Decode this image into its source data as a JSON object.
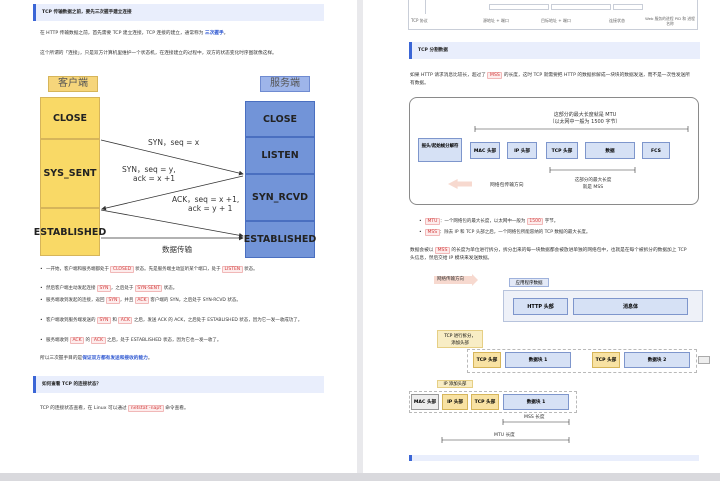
{
  "left": {
    "section_title": "TCP 传输数据之前，要先三次握手建立连接",
    "intro": [
      "在 HTTP 传输数据之前，首先需要 TCP 建立连接，TCP 连接的建立，通常称为 ",
      "三次握手",
      "。"
    ],
    "para2": "这个所谓的「连接」，只是双方计算机里维护一个状态机，在连接建立的过程中，双方的状态变化时序图就像这样。",
    "diagram": {
      "client_label": "客户端",
      "server_label": "服务端",
      "client_states": [
        "CLOSE",
        "SYS_SENT",
        "ESTABLISHED"
      ],
      "server_states": [
        "CLOSE",
        "LISTEN",
        "SYN_RCVD",
        "ESTABLISHED"
      ],
      "msg1": "SYN，seq = x",
      "msg2a": "SYN，seq = y,",
      "msg2b": "ack = x +1",
      "msg3a": "ACK，seq = x +1,",
      "msg3b": "ack = y + 1",
      "msg4": "数据传输"
    },
    "bullets": [
      {
        "pre": "一开始，客户端和服务端都处于 ",
        "t1": "CLOSED",
        "mid": " 状态。先是服务端主动监听某个端口，处于 ",
        "t2": "LISTEN",
        "post": " 状态。"
      },
      {
        "pre": "然后客户端主动发起连接 ",
        "t1": "SYN",
        "mid": "，之后处于 ",
        "t2": "SYN-SENT",
        "post": " 状态。"
      },
      {
        "pre": "服务端收到发起的连接，返回 ",
        "t1": "SYN",
        "mid": "，并且 ",
        "t2": "ACK",
        "post": " 客户端的 SYN，之后处于 SYN-RCVD 状态。"
      },
      {
        "pre": "客户端收到服务端发送的 ",
        "t1": "SYN",
        "mid": " 和 ",
        "t2": "ACK",
        "post": " 之后，发送 ACK 的 ACK，之后处于 ESTABLISHED 状态，因为它一发一收成功了。"
      },
      {
        "pre": "服务端收到 ",
        "t1": "ACK",
        "mid": " 的 ",
        "t2": "ACK",
        "post": " 之后，处于 ESTABLISHED 状态，因为它也一发一收了。"
      }
    ],
    "conclusion_pre": "所以三次握手目的是",
    "conclusion_hl": "保证双方都有发送和接收的能力",
    "conclusion_post": "。",
    "section2_title": "如何查看 TCP 的连接状态？",
    "para3_pre": "TCP 的连接状态查看，在 Linux 可以通过 ",
    "para3_tag": "netstat -napt",
    "para3_post": " 命令查看。"
  },
  "right": {
    "top_labels": [
      "TCP 协议",
      "源地址 + 端口",
      "目标地址 + 端口",
      "连接状态",
      "Web 服务的进程 PID 和 进程名称"
    ],
    "section_title": "TCP 分割数据",
    "para1_pre": "如果 HTTP 请求消息比较长，超过了 ",
    "para1_tag": "MSS",
    "para1_post": " 的长度，这时 TCP 就需要把 HTTP 的数据拆解成一块块的数据发送，而不是一次性发送所有数据。",
    "diag1": {
      "mtu_caption_a": "这部分的最大长度就是 MTU",
      "mtu_caption_b": "（以太网中一般为 1500 字节）",
      "cells": [
        "报头/起始帧分解符",
        "MAC 头部",
        "IP 头部",
        "TCP 头部",
        "数据",
        "FCS"
      ],
      "direction": "网络包传输方向",
      "mss_caption_a": "这部分的最大长度",
      "mss_caption_b": "就是 MSS"
    },
    "bullets": [
      {
        "tag": "MTU",
        "text": "：一个网络包的最大长度，以太网中一般为 ",
        "tag2": "1500",
        "post": " 字节。"
      },
      {
        "tag": "MSS",
        "text": "：除去 IP 和 TCP 头部之后，一个网络包所能容纳的 TCP 数据的最大长度。",
        "tag2": "",
        "post": ""
      }
    ],
    "para2_pre": "数据会被以 ",
    "para2_tag": "MSS",
    "para2_post": " 的长度为单位进行拆分，拆分出来的每一块数据都会被放进单独的网络包中，也就是在每个被拆分的数据加上 TCP 头信息，然后交给 IP 模块来发送数据。",
    "diag2": {
      "flow_label": "网络传输方向",
      "app_label": "应用程序数据",
      "http_header": "HTTP 头部",
      "body": "消息体",
      "tcp_split_a": "TCP 进行拆分，",
      "tcp_split_b": "添加头部",
      "tcp_header": "TCP 头部",
      "block1": "数据块 1",
      "block2": "数据块 2",
      "ip_add": "IP 添加头部",
      "mac_header": "MAC 头部",
      "ip_header": "IP 头部",
      "mss_len": "MSS 长度",
      "mtu_len": "MTU 长度"
    }
  }
}
